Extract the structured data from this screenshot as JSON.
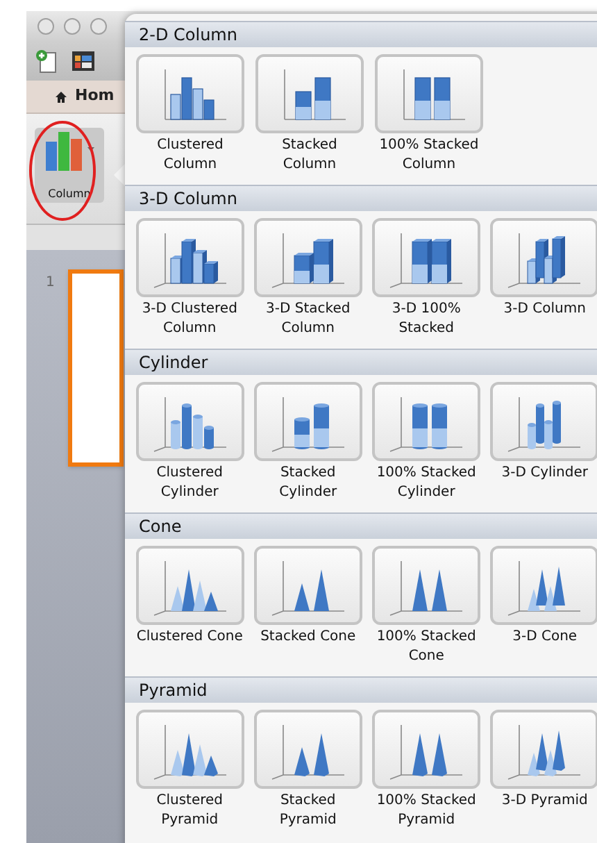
{
  "app": {
    "tab": "Hom",
    "chart_button": {
      "label": "Column",
      "selected": true
    },
    "slide_number": "1"
  },
  "gallery": {
    "sections": [
      {
        "title": "2-D Column",
        "kind": "flat",
        "items": [
          {
            "label": "Clustered\nColumn",
            "kind": "clustered"
          },
          {
            "label": "Stacked\nColumn",
            "kind": "stacked"
          },
          {
            "label": "100% Stacked\nColumn",
            "kind": "full"
          }
        ]
      },
      {
        "title": "3-D Column",
        "kind": "box",
        "items": [
          {
            "label": "3-D Clustered\nColumn",
            "kind": "clustered"
          },
          {
            "label": "3-D Stacked\nColumn",
            "kind": "stacked"
          },
          {
            "label": "3-D 100%\nStacked",
            "kind": "full"
          },
          {
            "label": "3-D Column",
            "kind": "depth"
          }
        ]
      },
      {
        "title": "Cylinder",
        "kind": "cylinder",
        "items": [
          {
            "label": "Clustered\nCylinder",
            "kind": "clustered"
          },
          {
            "label": "Stacked\nCylinder",
            "kind": "stacked"
          },
          {
            "label": "100% Stacked\nCylinder",
            "kind": "full"
          },
          {
            "label": "3-D Cylinder",
            "kind": "depth"
          }
        ]
      },
      {
        "title": "Cone",
        "kind": "cone",
        "items": [
          {
            "label": "Clustered Cone",
            "kind": "clustered"
          },
          {
            "label": "Stacked Cone",
            "kind": "stacked"
          },
          {
            "label": "100% Stacked\nCone",
            "kind": "full"
          },
          {
            "label": "3-D Cone",
            "kind": "depth"
          }
        ]
      },
      {
        "title": "Pyramid",
        "kind": "pyramid",
        "items": [
          {
            "label": "Clustered\nPyramid",
            "kind": "clustered"
          },
          {
            "label": "Stacked\nPyramid",
            "kind": "stacked"
          },
          {
            "label": "100% Stacked\nPyramid",
            "kind": "full"
          },
          {
            "label": "3-D Pyramid",
            "kind": "depth"
          }
        ]
      }
    ]
  }
}
